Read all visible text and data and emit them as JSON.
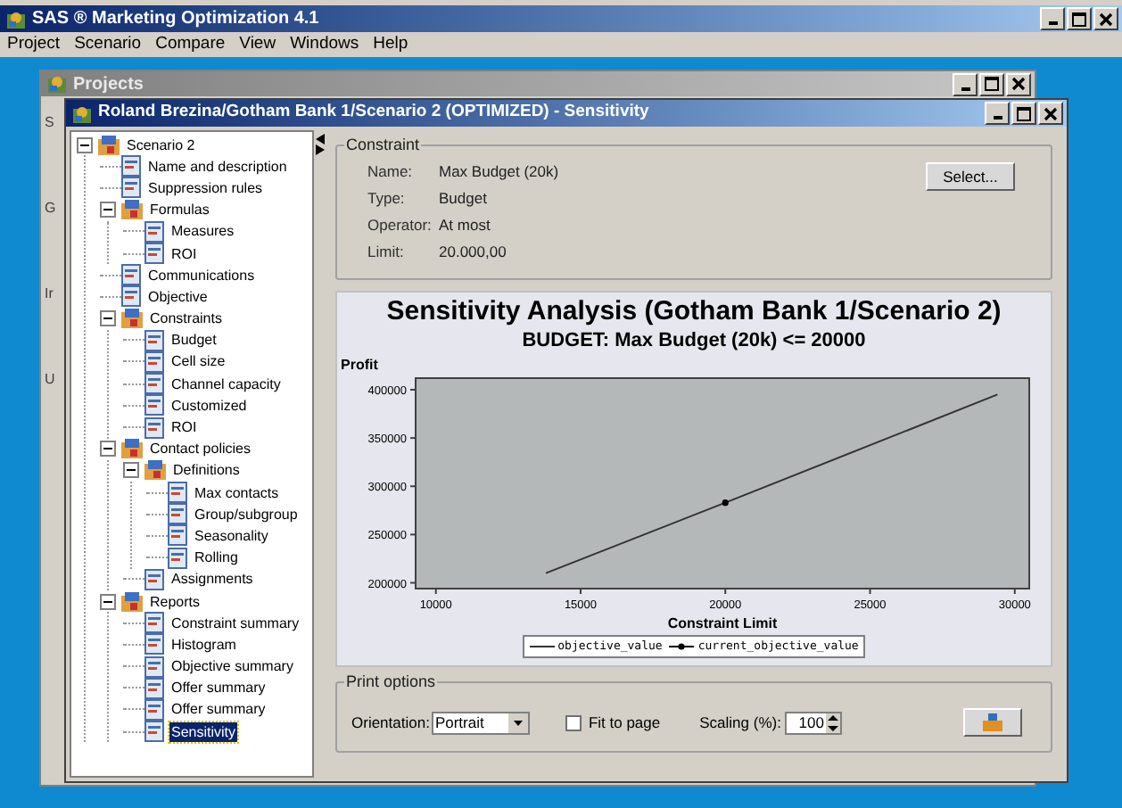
{
  "app_window": {
    "title": "SAS ® Marketing Optimization 4.1"
  },
  "menu": [
    "Project",
    "Scenario",
    "Compare",
    "View",
    "Windows",
    "Help"
  ],
  "projects_window": {
    "title": "Projects",
    "visible_fragments": [
      "S",
      "G",
      "Ir",
      "U"
    ]
  },
  "sensitivity_window": {
    "title": "Roland Brezina/Gotham Bank 1/Scenario 2 (OPTIMIZED) - Sensitivity"
  },
  "tree": [
    {
      "label": "Scenario 2",
      "expanded": true,
      "selected": false,
      "children": [
        {
          "label": "Name and description",
          "selected": false
        },
        {
          "label": "Suppression rules",
          "selected": false
        },
        {
          "label": "Formulas",
          "expanded": true,
          "selected": false,
          "children": [
            {
              "label": "Measures",
              "selected": false
            },
            {
              "label": "ROI",
              "selected": false
            }
          ]
        },
        {
          "label": "Communications",
          "selected": false
        },
        {
          "label": "Objective",
          "selected": false
        },
        {
          "label": "Constraints",
          "expanded": true,
          "selected": false,
          "children": [
            {
              "label": "Budget",
              "selected": false
            },
            {
              "label": "Cell size",
              "selected": false
            },
            {
              "label": "Channel capacity",
              "selected": false
            },
            {
              "label": "Customized",
              "selected": false
            },
            {
              "label": "ROI",
              "selected": false
            }
          ]
        },
        {
          "label": "Contact policies",
          "expanded": true,
          "selected": false,
          "children": [
            {
              "label": "Definitions",
              "expanded": true,
              "selected": false,
              "children": [
                {
                  "label": "Max contacts",
                  "selected": false
                },
                {
                  "label": "Group/subgroup",
                  "selected": false
                },
                {
                  "label": "Seasonality",
                  "selected": false
                },
                {
                  "label": "Rolling",
                  "selected": false
                }
              ]
            },
            {
              "label": "Assignments",
              "selected": false
            }
          ]
        },
        {
          "label": "Reports",
          "expanded": true,
          "selected": false,
          "children": [
            {
              "label": "Constraint summary",
              "selected": false
            },
            {
              "label": "Histogram",
              "selected": false
            },
            {
              "label": "Objective summary",
              "selected": false
            },
            {
              "label": "Offer summary",
              "selected": false
            },
            {
              "label": "Offer summary",
              "selected": false
            },
            {
              "label": "Sensitivity",
              "selected": true
            }
          ]
        }
      ]
    }
  ],
  "constraint": {
    "title": "Constraint",
    "fields": [
      {
        "label": "Name:",
        "value": "Max Budget (20k)"
      },
      {
        "label": "Type:",
        "value": "Budget"
      },
      {
        "label": "Operator:",
        "value": "At most"
      },
      {
        "label": "Limit:",
        "value": "20.000,00"
      }
    ],
    "select_button": "Select..."
  },
  "chart": {
    "title": "Sensitivity Analysis (Gotham Bank 1/Scenario 2)",
    "subtitle": "BUDGET: Max Budget (20k) <= 20000",
    "chart_data": {
      "type": "line",
      "xlabel": "Constraint Limit",
      "ylabel": "Profit",
      "x": [
        13800,
        20000,
        29400
      ],
      "series": [
        {
          "name": "objective_value",
          "color": "#333333",
          "values": [
            210000,
            283000,
            395000
          ]
        },
        {
          "name": "current_objective_value",
          "color": "#000000",
          "marker": "circle",
          "values": [
            null,
            283000,
            null
          ]
        }
      ],
      "legend": true,
      "xlim": [
        9300,
        30500
      ],
      "ylim": [
        194000,
        412000
      ],
      "xticks": [
        10000,
        15000,
        20000,
        25000,
        30000
      ],
      "yticks": [
        200000,
        250000,
        300000,
        350000,
        400000
      ]
    }
  },
  "print_options": {
    "title": "Print options",
    "orientation_label": "Orientation:",
    "orientation": "Portrait",
    "fit_label": "Fit to page",
    "fit_checked": false,
    "scaling_label": "Scaling (%):",
    "scaling": "100"
  }
}
